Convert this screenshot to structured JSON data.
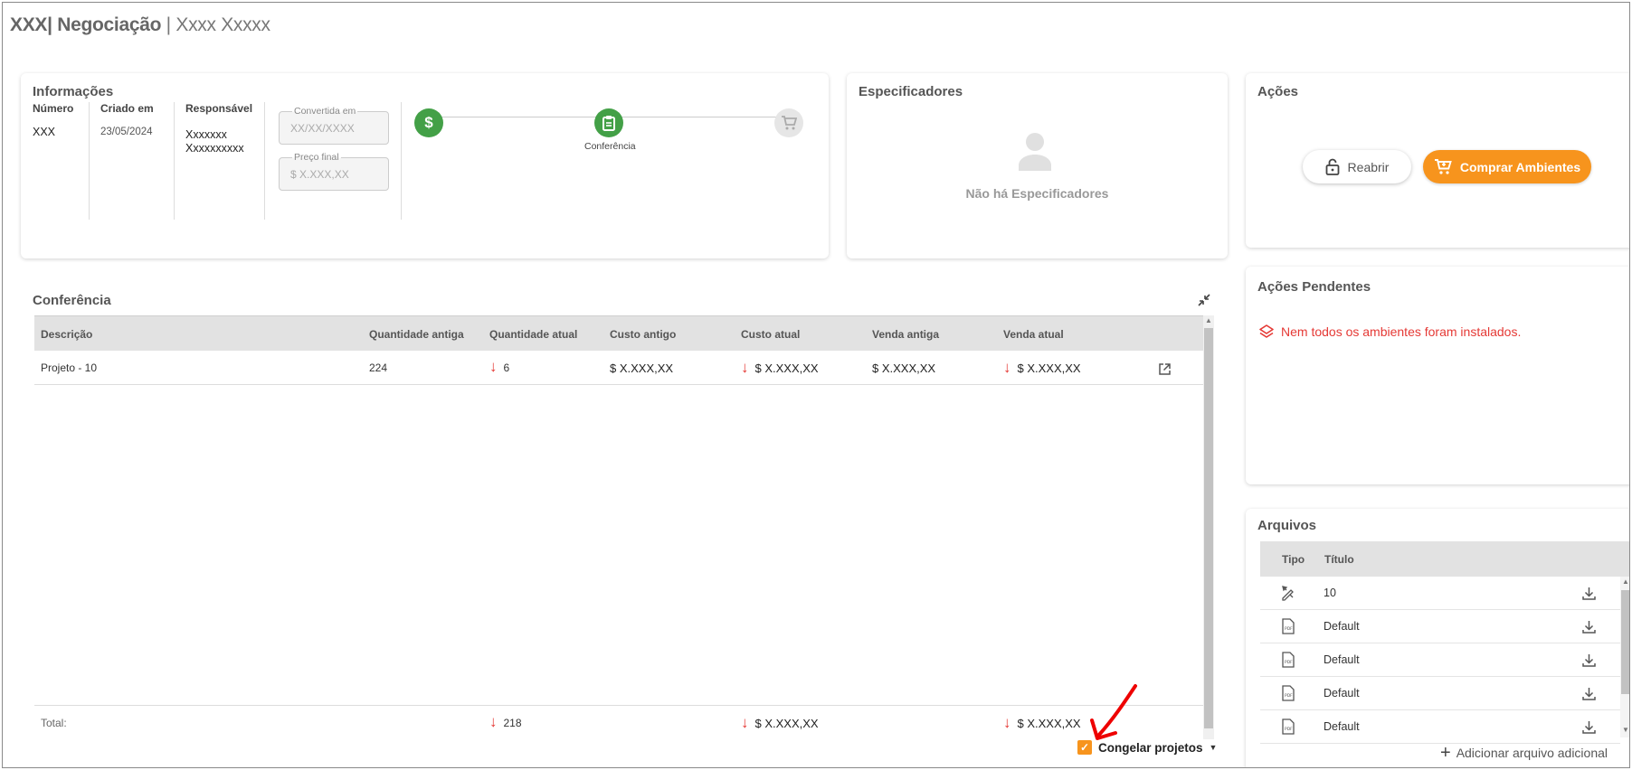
{
  "title": {
    "prefix": "XXX| Negociação",
    "suffix": "| Xxxx Xxxxx"
  },
  "info": {
    "title": "Informações",
    "numero": {
      "label": "Número",
      "value": "XXX"
    },
    "criado": {
      "label": "Criado em",
      "value": "23/05/2024"
    },
    "responsavel": {
      "label": "Responsável",
      "value1": "Xxxxxxx",
      "value2": "Xxxxxxxxxx"
    },
    "convertida": {
      "label": "Convertida em",
      "placeholder": "XX/XX/XXXX"
    },
    "preco": {
      "label": "Preço final",
      "placeholder": "$ X.XXX,XX"
    },
    "steps": [
      {
        "icon": "dollar-icon",
        "label": "",
        "color": "#43a047"
      },
      {
        "icon": "clipboard-icon",
        "label": "Conferência",
        "color": "#43a047"
      },
      {
        "icon": "cart-icon",
        "label": "",
        "color": "#e0e0e0"
      }
    ]
  },
  "especificadores": {
    "title": "Especificadores",
    "empty": "Não há Especificadores"
  },
  "acoes": {
    "title": "Ações",
    "reabrir": "Reabrir",
    "comprar": "Comprar Ambientes",
    "accent": "#f7941d"
  },
  "conferencia": {
    "title": "Conferência",
    "columns": [
      "Descrição",
      "Quantidade antiga",
      "Quantidade atual",
      "Custo antigo",
      "Custo atual",
      "Venda antiga",
      "Venda atual"
    ],
    "rows": [
      {
        "descricao": "Projeto - 10",
        "qtd_antiga": "224",
        "qtd_atual": "6",
        "custo_antigo": "$ X.XXX,XX",
        "custo_atual": "$ X.XXX,XX",
        "venda_antiga": "$ X.XXX,XX",
        "venda_atual": "$ X.XXX,XX"
      }
    ],
    "total": {
      "label": "Total:",
      "qtd_atual": "218",
      "custo_atual": "$ X.XXX,XX",
      "venda_atual": "$ X.XXX,XX"
    },
    "freeze_label": "Congelar projetos",
    "freeze_checked": true,
    "down_color": "#e53935"
  },
  "pendentes": {
    "title": "Ações Pendentes",
    "message": "Nem todos os ambientes foram instalados."
  },
  "arquivos": {
    "title": "Arquivos",
    "columns": [
      "Tipo",
      "Título"
    ],
    "files": [
      {
        "type": "design-tool-icon",
        "title": "10"
      },
      {
        "type": "pdf-file-icon",
        "title": "Default"
      },
      {
        "type": "pdf-file-icon",
        "title": "Default"
      },
      {
        "type": "pdf-file-icon",
        "title": "Default"
      },
      {
        "type": "pdf-file-icon",
        "title": "Default"
      }
    ],
    "add_label": "Adicionar arquivo adicional"
  }
}
